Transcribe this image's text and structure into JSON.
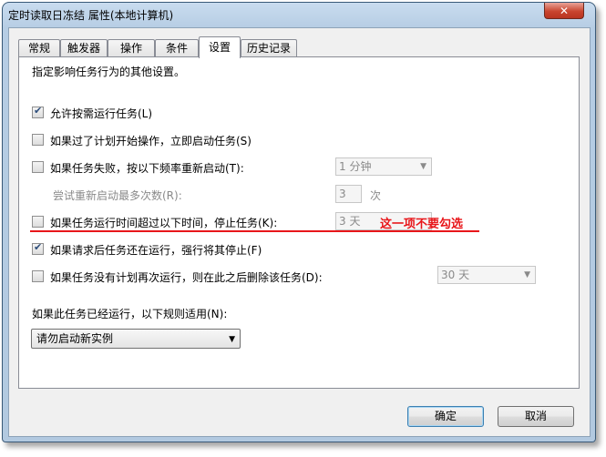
{
  "window": {
    "title": "定时读取日冻结 属性(本地计算机)",
    "close_glyph": "✕"
  },
  "tabs": [
    {
      "label": "常规"
    },
    {
      "label": "触发器"
    },
    {
      "label": "操作"
    },
    {
      "label": "条件"
    },
    {
      "label": "设置",
      "active": true
    },
    {
      "label": "历史记录"
    }
  ],
  "settings": {
    "description": "指定影响任务行为的其他设置。",
    "allow_on_demand": {
      "label": "允许按需运行任务(L)",
      "checked": true
    },
    "run_if_missed": {
      "label": "如果过了计划开始操作，立即启动任务(S)",
      "checked": false
    },
    "restart_on_fail": {
      "label": "如果任务失败，按以下频率重新启动(T):",
      "checked": false,
      "interval_value": "1 分钟"
    },
    "retry_attempts": {
      "label": "尝试重新启动最多次数(R):",
      "value": "3",
      "unit": "次"
    },
    "stop_if_longer": {
      "label": "如果任务运行时间超过以下时间，停止任务(K):",
      "checked": false,
      "value": "3 天"
    },
    "force_stop": {
      "label": "如果请求后任务还在运行，强行将其停止(F)",
      "checked": true
    },
    "delete_if_not_scheduled": {
      "label": "如果任务没有计划再次运行，则在此之后删除该任务(D):",
      "checked": false,
      "value": "30 天"
    },
    "rule_label": "如果此任务已经运行，以下规则适用(N):",
    "rule_value": "请勿启动新实例"
  },
  "annotation": {
    "text": "这一项不要勾选",
    "color": "#e8161a"
  },
  "buttons": {
    "ok": "确定",
    "cancel": "取消"
  },
  "check_glyph": "✔",
  "arrow_glyph": "▼"
}
